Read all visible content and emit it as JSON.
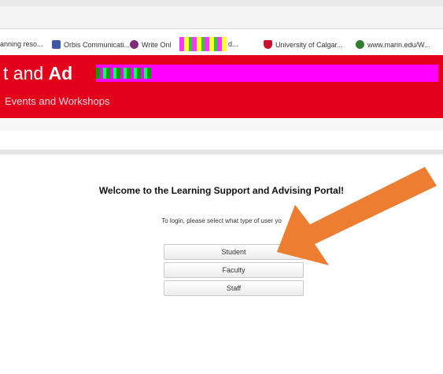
{
  "bookmarks": [
    {
      "label": "anning reso...",
      "icon": "bookmark-page-icon",
      "color": "#ffffff"
    },
    {
      "label": "Orbis Communicati...",
      "icon": "orbis-logo-icon",
      "color": "#3f59a8"
    },
    {
      "label": "Write Onl",
      "icon": "write-online-icon",
      "color": "#7a2e7a"
    },
    {
      "label": "d...",
      "icon": "bookmark-icon",
      "color": "#c2185b"
    },
    {
      "label": "University of Calgar...",
      "icon": "university-shield-icon",
      "color": "#c8102e"
    },
    {
      "label": "www.marin.edu/W...",
      "icon": "globe-icon",
      "color": "#2e7d32"
    }
  ],
  "banner": {
    "title_start": "t and ",
    "title_bold": "Ad",
    "subtitle": "Events and Workshops",
    "color": "#e2001a"
  },
  "main": {
    "welcome": "Welcome to the Learning Support and Advising Portal!",
    "prompt": "To login, please select what type of user yo",
    "buttons": [
      "Student",
      "Faculty",
      "Staff"
    ]
  },
  "annotation": {
    "arrow_color": "#ed7d31"
  }
}
